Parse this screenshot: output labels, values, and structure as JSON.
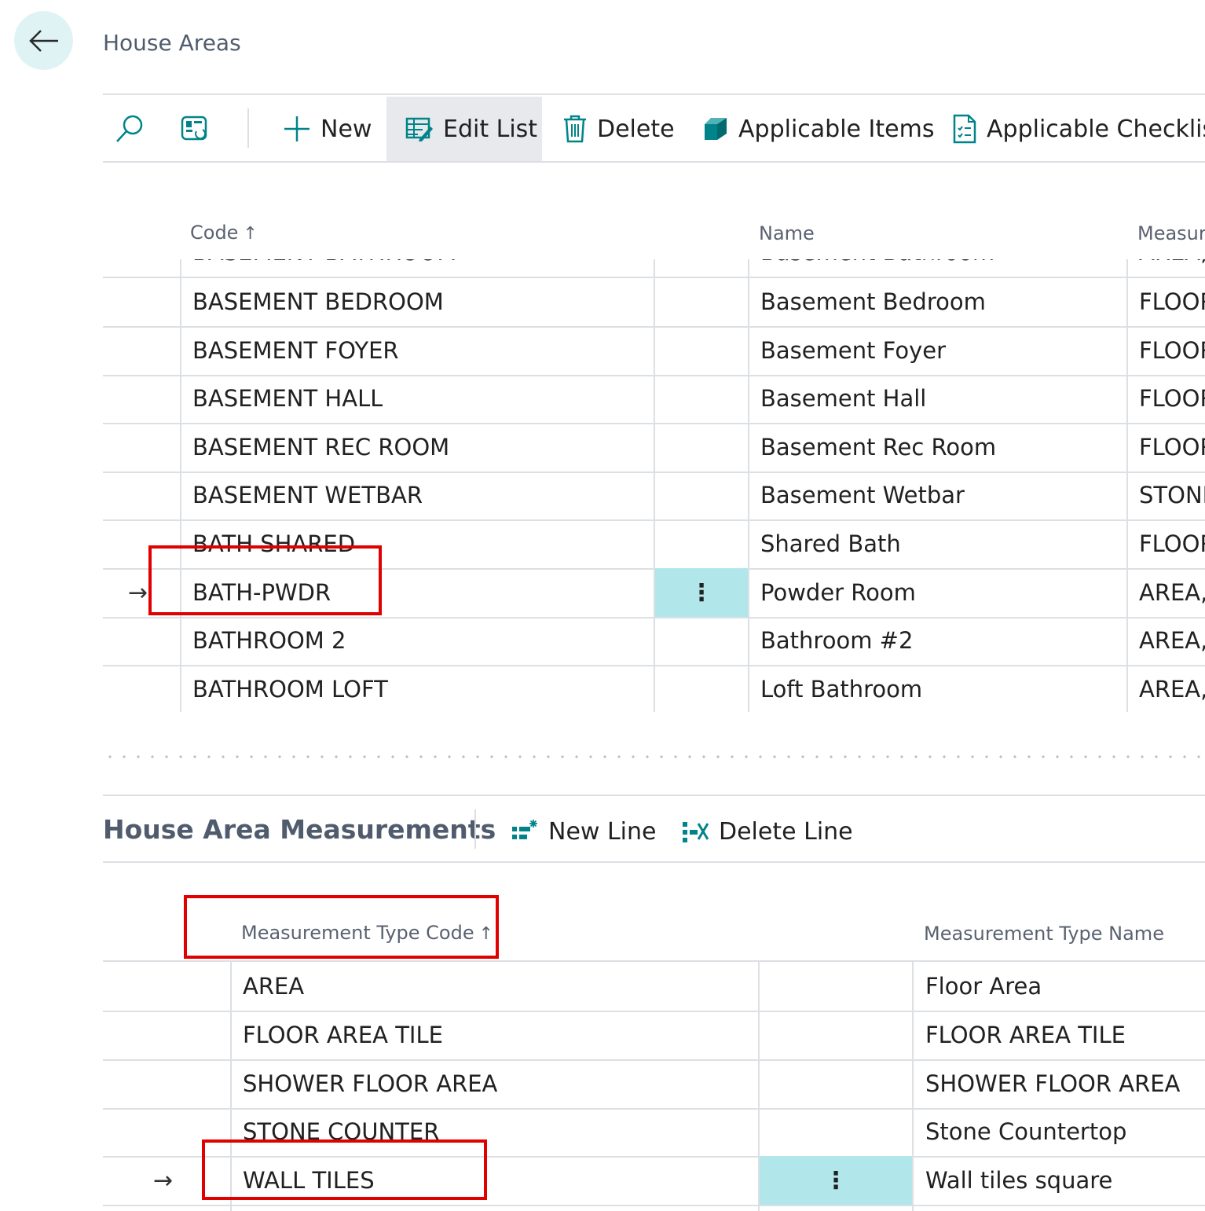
{
  "header": {
    "back_label": "Back",
    "title": "House Areas"
  },
  "toolbar": {
    "search_icon": "search-icon",
    "filter_icon": "filter-pane-icon",
    "new_label": "New",
    "edit_list_label": "Edit List",
    "delete_label": "Delete",
    "applicable_items_label": "Applicable Items",
    "applicable_checklist_label": "Applicable Checklist"
  },
  "main_list": {
    "columns": {
      "code": "Code",
      "name": "Name",
      "measurement": "Measur"
    },
    "sort_indicator": "↑",
    "partial_row": {
      "code": "BASEMENT BATHROOM",
      "name": "Basement Bathroom",
      "measurement": "AREA,"
    },
    "rows": [
      {
        "code": "BASEMENT BEDROOM",
        "name": "Basement Bedroom",
        "measurement": "FLOOR"
      },
      {
        "code": "BASEMENT FOYER",
        "name": "Basement Foyer",
        "measurement": "FLOOR"
      },
      {
        "code": "BASEMENT HALL",
        "name": "Basement Hall",
        "measurement": "FLOOR"
      },
      {
        "code": "BASEMENT REC ROOM",
        "name": "Basement Rec Room",
        "measurement": "FLOOR"
      },
      {
        "code": "BASEMENT WETBAR",
        "name": "Basement Wetbar",
        "measurement": "STONE"
      },
      {
        "code": "BATH SHARED",
        "name": "Shared Bath",
        "measurement": "FLOOR"
      },
      {
        "code": "BATH-PWDR",
        "name": "Powder Room",
        "measurement": "AREA,",
        "selected": true
      },
      {
        "code": "BATHROOM 2",
        "name": "Bathroom #2",
        "measurement": "AREA,"
      },
      {
        "code": "BATHROOM LOFT",
        "name": "Loft Bathroom",
        "measurement": "AREA,"
      }
    ],
    "row_marker": "→",
    "row_menu": "⋮"
  },
  "measurements": {
    "title": "House Area Measurements",
    "new_line_label": "New Line",
    "delete_line_label": "Delete Line",
    "columns": {
      "type_code": "Measurement Type Code",
      "type_name": "Measurement Type Name"
    },
    "rows": [
      {
        "code": "AREA",
        "name": "Floor Area"
      },
      {
        "code": "FLOOR AREA TILE",
        "name": "FLOOR AREA TILE"
      },
      {
        "code": "SHOWER FLOOR AREA",
        "name": "SHOWER FLOOR AREA"
      },
      {
        "code": "STONE COUNTER",
        "name": "Stone Countertop"
      },
      {
        "code": "WALL TILES",
        "name": "Wall tiles square",
        "selected": true
      }
    ]
  },
  "colors": {
    "accent": "#008489",
    "selected_cell": "#b1e6ea",
    "highlight_box": "#e00000",
    "back_button_bg": "#e0f3f4"
  }
}
